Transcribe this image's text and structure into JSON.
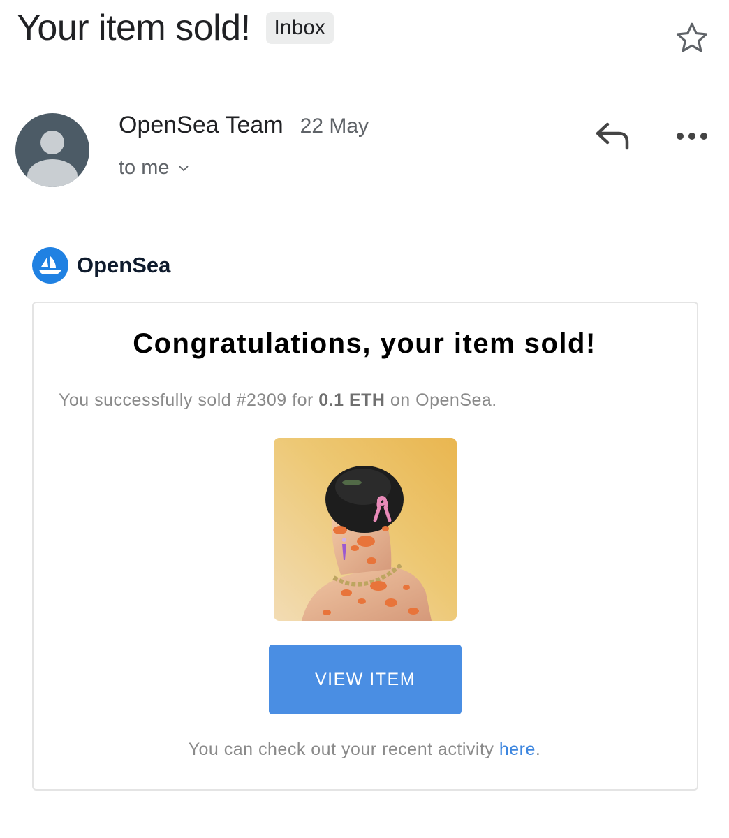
{
  "email": {
    "subject": "Your item sold!",
    "label": "Inbox",
    "sender": "OpenSea Team",
    "date": "22 May",
    "recipient": "to me"
  },
  "icons": {
    "star": "star-icon",
    "reply": "reply-icon",
    "more": "more-options-icon",
    "avatar": "person-icon",
    "chevron": "chevron-down-icon",
    "logo": "opensea-logo-icon"
  },
  "message": {
    "brand": "OpenSea",
    "title": "Congratulations, your item sold!",
    "body_prefix": "You successfully sold #2309 for",
    "amount": "0.1 ETH",
    "body_suffix": "on OpenSea.",
    "button_label": "VIEW ITEM",
    "footer_text": "You can check out your recent activity",
    "footer_link": "here",
    "footer_end": "."
  },
  "colors": {
    "accent": "#4a8ee3",
    "link": "#3d86df",
    "opensea_blue": "#2081e2",
    "avatar_bg": "#4c5b66"
  }
}
